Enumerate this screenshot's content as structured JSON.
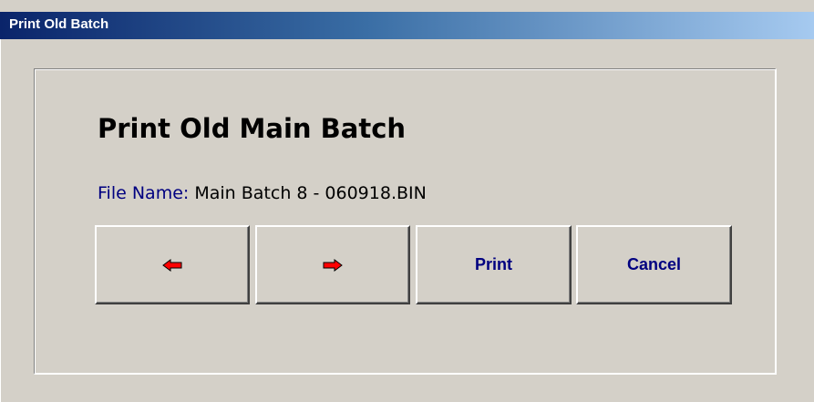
{
  "window": {
    "title": "Print Old Batch"
  },
  "dialog": {
    "heading": "Print Old Main Batch",
    "file_name_label": "File Name:",
    "file_name_value": "Main Batch 8 - 060918.BIN"
  },
  "buttons": {
    "previous": {
      "icon": "left-arrow-icon",
      "color": "#ff0000"
    },
    "next": {
      "icon": "right-arrow-icon",
      "color": "#ff0000"
    },
    "print_label": "Print",
    "cancel_label": "Cancel"
  },
  "colors": {
    "title_gradient_start": "#0a246a",
    "title_gradient_end": "#a6caf0",
    "face": "#d4d0c8",
    "label_blue": "#000080"
  }
}
